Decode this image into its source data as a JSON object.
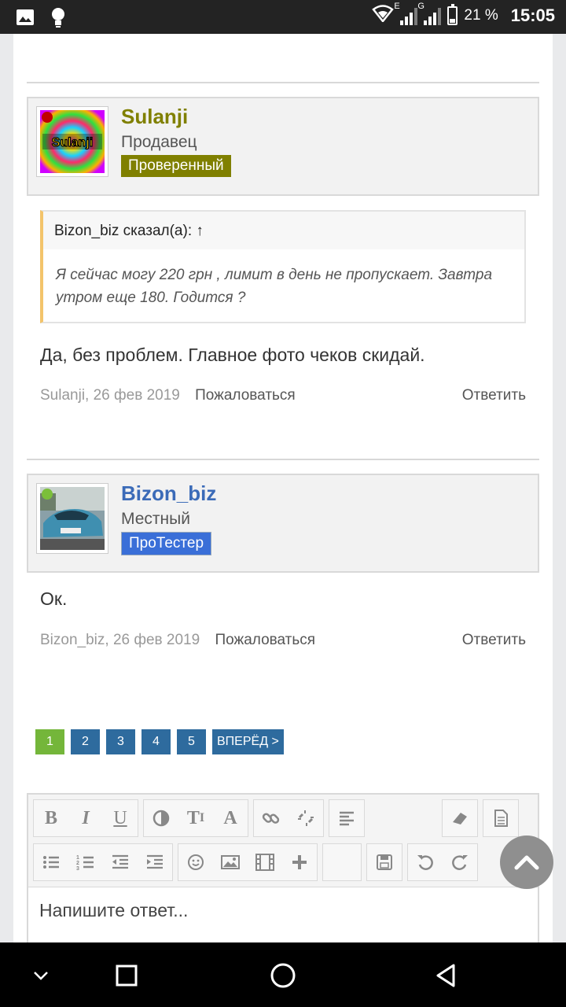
{
  "status_bar": {
    "battery": "21 %",
    "time": "15:05",
    "net1": "E",
    "net2": "G"
  },
  "posts": [
    {
      "username": "Sulanji",
      "avatar_text": "Sulanji",
      "role": "Продавец",
      "badge": "Проверенный",
      "online_color": "#c00000",
      "name_color": "#808000",
      "badge_bg": "#808000",
      "quote": {
        "header": "Bizon_biz сказал(а): ↑",
        "text": "Я сейчас могу 220 грн , лимит в день не пропускает. Завтра утром еще 180. Годится ?"
      },
      "message": "Да, без проблем. Главное фото чеков скидай.",
      "author_date": "Sulanji, 26 фев 2019",
      "report": "Пожаловаться",
      "reply": "Ответить"
    },
    {
      "username": "Bizon_biz",
      "role": "Местный",
      "badge": "ПроТестер",
      "online_color": "#7bbf3a",
      "name_color": "#3b6bb8",
      "badge_bg": "#3a6fd8",
      "message": "Ок.",
      "author_date": "Bizon_biz, 26 фев 2019",
      "report": "Пожаловаться",
      "reply": "Ответить"
    }
  ],
  "pagination": {
    "pages": [
      "1",
      "2",
      "3",
      "4",
      "5"
    ],
    "current": "1",
    "next": "ВПЕРЁД >"
  },
  "editor": {
    "placeholder": "Напишите ответ...",
    "toolbar_row1": [
      "bold-icon",
      "italic-icon",
      "underline-icon",
      "color-icon",
      "font-size-icon",
      "font-icon",
      "link-icon",
      "unlink-icon",
      "align-icon",
      "eraser-icon",
      "template-icon"
    ],
    "toolbar_row2": [
      "bullet-list-icon",
      "numbered-list-icon",
      "outdent-icon",
      "indent-icon",
      "smiley-icon",
      "image-icon",
      "media-icon",
      "insert-icon",
      "save-icon",
      "undo-icon",
      "redo-icon"
    ]
  }
}
